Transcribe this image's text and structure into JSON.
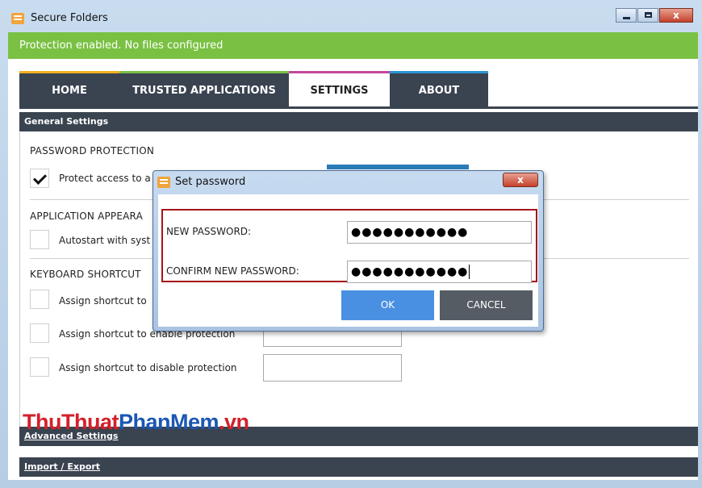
{
  "window": {
    "title": "Secure Folders",
    "close_glyph": "x"
  },
  "status": {
    "text": "Protection enabled. No files configured",
    "color": "#7ac143"
  },
  "tabs": [
    {
      "label": "HOME",
      "active": false,
      "accent": "#f2b01e"
    },
    {
      "label": "TRUSTED APPLICATIONS",
      "active": false,
      "accent": "#7ac143"
    },
    {
      "label": "SETTINGS",
      "active": true,
      "accent": "#c2489a"
    },
    {
      "label": "ABOUT",
      "active": false,
      "accent": "#2b95d6"
    }
  ],
  "settings": {
    "general_header": "General Settings",
    "password_group": "PASSWORD PROTECTION",
    "password_option": {
      "label": "Protect access to a",
      "checked": true
    },
    "appearance_group": "APPLICATION APPEARA",
    "appearance_option": {
      "label": "Autostart with syst",
      "checked": false
    },
    "keyboard_group": "KEYBOARD SHORTCUT",
    "shortcut_options": [
      {
        "label": "Assign shortcut to",
        "checked": false
      },
      {
        "label": "Assign shortcut to enable protection",
        "checked": false
      },
      {
        "label": "Assign shortcut to disable protection",
        "checked": false
      }
    ],
    "advanced_header": "Advanced Settings",
    "import_export_header": "Import / Export"
  },
  "watermark": {
    "part1": "Thu",
    "part2": "Thuat",
    "part3": "PhanMem",
    "part4": ".vn"
  },
  "dialog": {
    "title": "Set password",
    "close_glyph": "x",
    "new_password_label": "NEW PASSWORD:",
    "new_password_value": "●●●●●●●●●●●",
    "confirm_password_label": "CONFIRM NEW PASSWORD:",
    "confirm_password_value": "●●●●●●●●●●●",
    "ok_label": "OK",
    "cancel_label": "CANCEL"
  }
}
